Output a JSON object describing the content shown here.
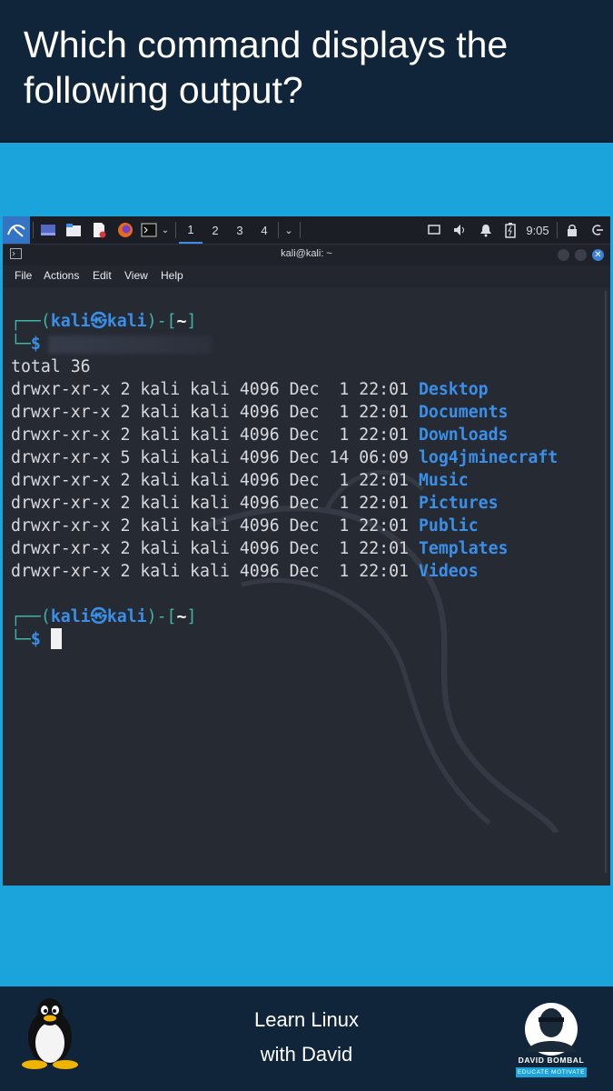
{
  "question": "Which command displays the following output?",
  "panel": {
    "workspaces": [
      "1",
      "2",
      "3",
      "4"
    ],
    "active_workspace": "1",
    "clock": "9:05",
    "icons": [
      "kali-menu-icon",
      "show-desktop-icon",
      "file-manager-icon",
      "text-editor-icon",
      "firefox-icon",
      "terminal-icon",
      "chevron-down-icon",
      "screen-icon",
      "volume-icon",
      "notification-bell-icon",
      "battery-icon",
      "lock-icon",
      "logout-icon"
    ]
  },
  "window": {
    "title": "kali@kali: ~",
    "menu": [
      "File",
      "Actions",
      "Edit",
      "View",
      "Help"
    ]
  },
  "terminal": {
    "prompt_open": "┌──(",
    "user": "kali",
    "at_symbol": "㉿",
    "host": "kali",
    "prompt_mid": ")-[",
    "cwd": "~",
    "prompt_close": "]",
    "prompt_line2": "└─",
    "dollar": "$",
    "total": "total 36",
    "entries": [
      {
        "meta": "drwxr-xr-x 2 kali kali 4096 Dec  1 22:01 ",
        "name": "Desktop"
      },
      {
        "meta": "drwxr-xr-x 2 kali kali 4096 Dec  1 22:01 ",
        "name": "Documents"
      },
      {
        "meta": "drwxr-xr-x 2 kali kali 4096 Dec  1 22:01 ",
        "name": "Downloads"
      },
      {
        "meta": "drwxr-xr-x 5 kali kali 4096 Dec 14 06:09 ",
        "name": "log4jminecraft"
      },
      {
        "meta": "drwxr-xr-x 2 kali kali 4096 Dec  1 22:01 ",
        "name": "Music"
      },
      {
        "meta": "drwxr-xr-x 2 kali kali 4096 Dec  1 22:01 ",
        "name": "Pictures"
      },
      {
        "meta": "drwxr-xr-x 2 kali kali 4096 Dec  1 22:01 ",
        "name": "Public"
      },
      {
        "meta": "drwxr-xr-x 2 kali kali 4096 Dec  1 22:01 ",
        "name": "Templates"
      },
      {
        "meta": "drwxr-xr-x 2 kali kali 4096 Dec  1 22:01 ",
        "name": "Videos"
      }
    ]
  },
  "footer": {
    "line1": "Learn Linux",
    "line2": "with David",
    "logo_name": "DAVID BOMBAL",
    "logo_tagline": "EDUCATE MOTIVATE"
  },
  "colors": {
    "background": "#1ba4dc",
    "banner": "#10253a",
    "directory": "#3a8fe8",
    "prompt": "#3fb3a5"
  }
}
